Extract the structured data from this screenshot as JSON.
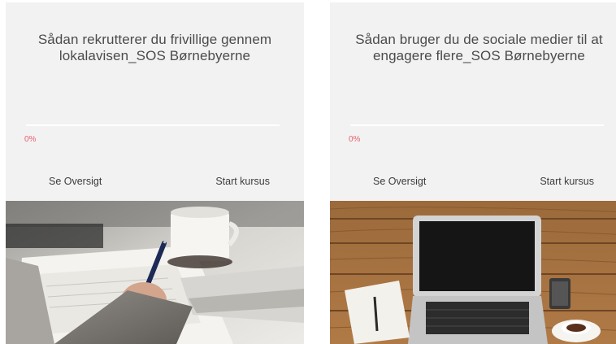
{
  "courses": [
    {
      "title": "Sådan rekrutterer du frivillige gennem lokalavisen_SOS Børnebyerne",
      "progress_text": "0%",
      "progress_value": 0,
      "overview_label": "Se Oversigt",
      "start_label": "Start kursus",
      "image": "photo of a person writing notes at a desk with a coffee cup and laptop"
    },
    {
      "title": "Sådan bruger du de sociale medier til at engagere flere_SOS Børnebyerne",
      "progress_text": "0%",
      "progress_value": 0,
      "overview_label": "Se Oversigt",
      "start_label": "Start kursus",
      "image": "photo of an open laptop on a wooden table with a notebook, phone and espresso cup"
    }
  ],
  "colors": {
    "card_background": "#f2f2f2",
    "progress_accent": "#e8606f",
    "text": "#4b4b4b"
  }
}
